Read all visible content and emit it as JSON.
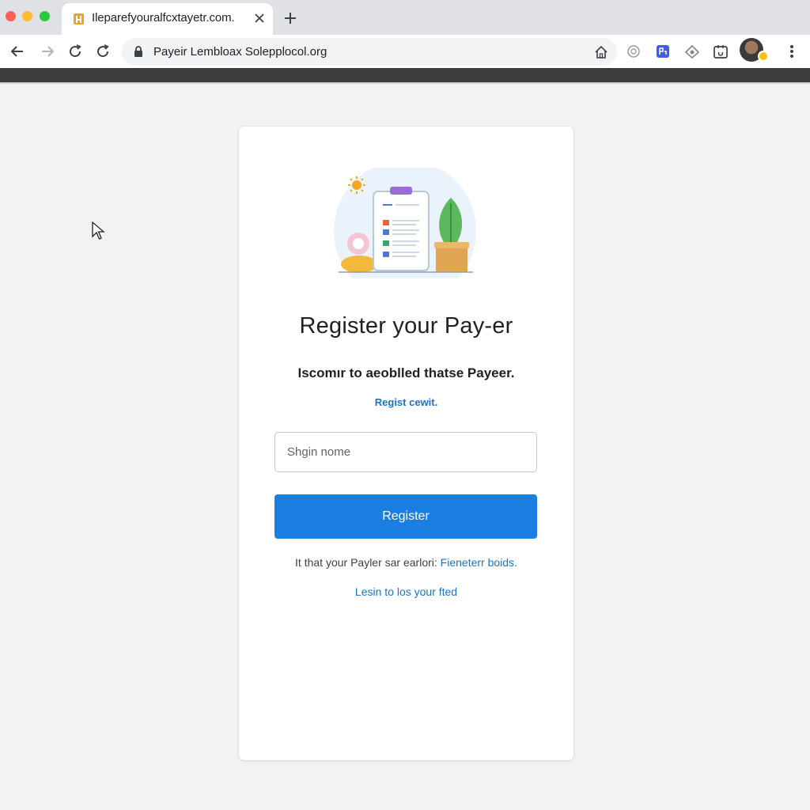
{
  "browser": {
    "tab_title": "Ileparefyouralfcxtayetr.com.",
    "url": "Payeir Lembloax Solepplocol.org",
    "icons": {
      "back": "arrow-left-icon",
      "forward": "arrow-right-icon",
      "reload": "reload-icon",
      "refresh": "refresh-icon",
      "lock": "lock-icon",
      "bookmark": "home-icon",
      "menu": "more-vertical-icon"
    }
  },
  "card": {
    "title": "Register your Pay-er",
    "subtitle": "Iscomır to aeoblled thatse Payeer.",
    "small_link": "Regist cewit.",
    "input_placeholder": "Shgin nome",
    "button_label": "Register",
    "footer_text": "It that your Payler sar earlori:",
    "footer_link": "Fieneterr boids.",
    "login_link": "Lesin to los your fted"
  },
  "colors": {
    "accent": "#1a7fe0",
    "link": "#1a73c7",
    "background": "#f1f2f3"
  }
}
